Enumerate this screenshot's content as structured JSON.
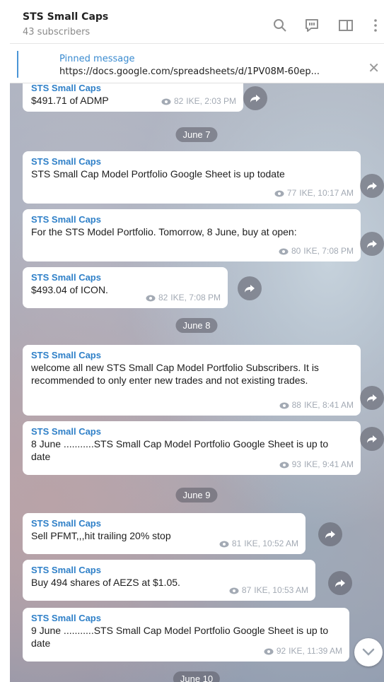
{
  "header": {
    "title": "STS Small Caps",
    "subscribers": "43 subscribers",
    "icons": [
      "search-icon",
      "comment-icon",
      "sidebar-icon",
      "more-icon"
    ]
  },
  "pinned": {
    "title": "Pinned message",
    "text": "https://docs.google.com/spreadsheets/d/1PV08M-60ep..."
  },
  "messages": [
    {
      "sender": "STS Small Caps",
      "text": "$491.71 of ADMP",
      "views": "82",
      "time": "IKE, 2:03 PM"
    },
    {
      "date": "June 7"
    },
    {
      "sender": "STS Small Caps",
      "text": "STS Small Cap Model Portfolio Google Sheet is up todate",
      "views": "77",
      "time": "IKE, 10:17 AM"
    },
    {
      "sender": "STS Small Caps",
      "text": "For the STS Model Portfolio. Tomorrow,  8  June, buy at open:",
      "views": "80",
      "time": "IKE, 7:08 PM"
    },
    {
      "sender": "STS Small Caps",
      "text": "$493.04 of ICON.",
      "views": "82",
      "time": "IKE, 7:08 PM"
    },
    {
      "date": "June 8"
    },
    {
      "sender": "STS Small Caps",
      "text": "welcome all new STS Small Cap Model Portfolio Subscribers. It is recommended to only enter new trades and not existing trades.",
      "views": "88",
      "time": "IKE, 8:41 AM"
    },
    {
      "sender": "STS Small Caps",
      "text": "8 June ...........STS Small Cap Model Portfolio Google Sheet is up to date",
      "views": "93",
      "time": "IKE, 9:41 AM"
    },
    {
      "date": "June 9"
    },
    {
      "sender": "STS Small Caps",
      "text": "Sell PFMT,,,hit trailing 20% stop",
      "views": "81",
      "time": "IKE, 10:52 AM"
    },
    {
      "sender": "STS Small Caps",
      "text": "Buy  494 shares of AEZS at $1.05.",
      "views": "87",
      "time": "IKE, 10:53 AM"
    },
    {
      "sender": "STS Small Caps",
      "text": "9 June ...........STS Small Cap Model Portfolio Google Sheet is up to date",
      "views": "92",
      "time": "IKE, 11:39 AM"
    },
    {
      "date": "June 10"
    }
  ],
  "colors": {
    "accent": "#2f80c8",
    "pin_bar": "#4a95d6"
  }
}
